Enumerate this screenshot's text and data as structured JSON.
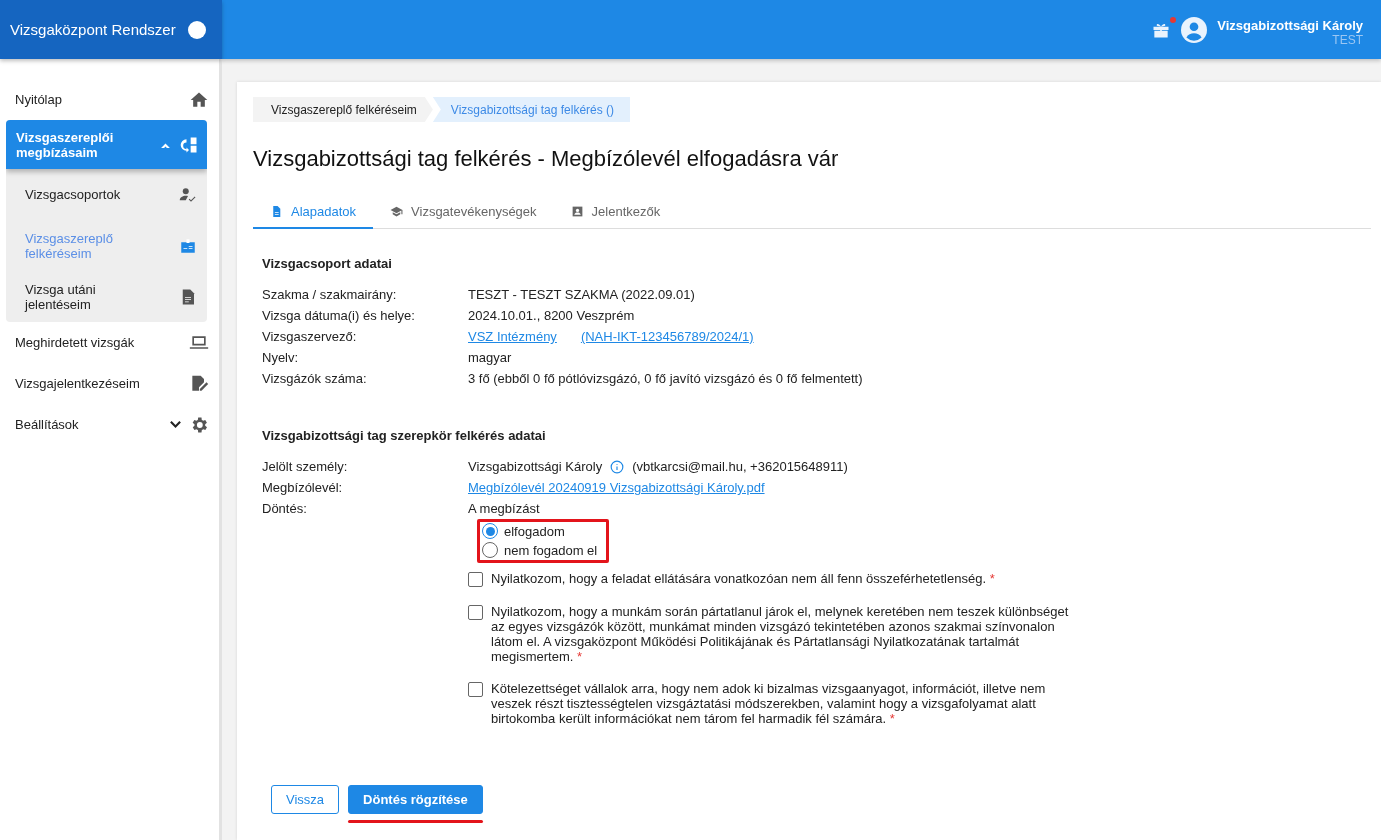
{
  "app": {
    "title": "Vizsgaközpont Rendszer",
    "user_name": "Vizsgabizottsági Károly",
    "user_role": "TEST",
    "notification": true
  },
  "sidebar": {
    "items": [
      {
        "label": "Nyitólap",
        "selected": false
      },
      {
        "label": "Vizsgaszereplői megbízásaim",
        "selected": true,
        "expanded": true,
        "children": [
          {
            "label": "Vizsgacsoportok",
            "selected": false
          },
          {
            "label": "Vizsgaszereplő felkéréseim",
            "selected": true
          },
          {
            "label": "Vizsga utáni jelentéseim",
            "selected": false
          }
        ]
      },
      {
        "label": "Meghirdetett vizsgák",
        "selected": false
      },
      {
        "label": "Vizsgajelentkezéseim",
        "selected": false
      },
      {
        "label": "Beállítások",
        "selected": false,
        "expanded": false
      }
    ]
  },
  "breadcrumb": [
    {
      "label": "Vizsgaszereplő felkéréseim",
      "selected": false
    },
    {
      "label": "Vizsgabizottsági tag felkérés ()",
      "selected": true
    }
  ],
  "page_title": "Vizsgabizottsági tag felkérés - Megbízólevél elfogadásra vár",
  "tabs": [
    {
      "label": "Alapadatok",
      "selected": true
    },
    {
      "label": "Vizsgatevékenységek",
      "selected": false
    },
    {
      "label": "Jelentkezők",
      "selected": false
    }
  ],
  "group_section": {
    "heading": "Vizsgacsoport adatai",
    "rows": [
      {
        "kind": "text",
        "label": "Szakma / szakmairány:",
        "value": "TESZT - TESZT SZAKMA (2022.09.01)"
      },
      {
        "kind": "text",
        "label": "Vizsga dátuma(i) és helye:",
        "value": "2024.10.01., 8200 Veszprém"
      },
      {
        "kind": "links",
        "label": "Vizsgaszervező:",
        "links": [
          "VSZ Intézmény",
          "(NAH-IKT-123456789/2024/1)"
        ]
      },
      {
        "kind": "text",
        "label": "Nyelv:",
        "value": "magyar"
      },
      {
        "kind": "text",
        "label": "Vizsgázók száma:",
        "value": "3 fő (ebből 0 fő pótlóvizsgázó, 0 fő javító vizsgázó és 0 fő felmentett)"
      }
    ]
  },
  "request_section": {
    "heading": "Vizsgabizottsági tag szerepkör felkérés adatai",
    "rows": [
      {
        "kind": "person",
        "label": "Jelölt személy:",
        "name": "Vizsgabizottsági Károly",
        "contact": "(vbtkarcsi@mail.hu, +362015648911)"
      },
      {
        "kind": "links",
        "label": "Megbízólevél:",
        "links": [
          "Megbízólevél 20240919 Vizsgabizottsági Károly.pdf"
        ]
      },
      {
        "kind": "text",
        "label": "Döntés:",
        "value": "A megbízást"
      }
    ]
  },
  "decision_options": [
    {
      "label": "elfogadom",
      "selected": true
    },
    {
      "label": "nem fogadom el",
      "selected": false
    }
  ],
  "declarations": [
    {
      "text": "Nyilatkozom, hogy a feladat ellátására vonatkozóan nem áll fenn összeférhetetlenség.",
      "required_mark": "*",
      "checked": false
    },
    {
      "text": "Nyilatkozom, hogy a munkám során pártatlanul járok el, melynek keretében nem teszek különbséget az egyes vizsgázók között, munkámat minden vizsgázó tekintetében azonos szakmai színvonalon látom el. A vizsgaközpont Működési Politikájának és Pártatlansági Nyilatkozatának tartalmát megismertem.",
      "required_mark": "*",
      "checked": false
    },
    {
      "text": "Kötelezettséget vállalok arra, hogy nem adok ki bizalmas vizsgaanyagot, információt, illetve nem veszek részt tisztességtelen vizsgáztatási módszerekben, valamint hogy a vizsgafolyamat alatt birtokomba került információkat nem tárom fel harmadik fél számára.",
      "required_mark": "*",
      "checked": false
    }
  ],
  "buttons": [
    {
      "kind": "secondary",
      "label": "Vissza"
    },
    {
      "kind": "primary",
      "label": "Döntés rögzítése"
    }
  ]
}
